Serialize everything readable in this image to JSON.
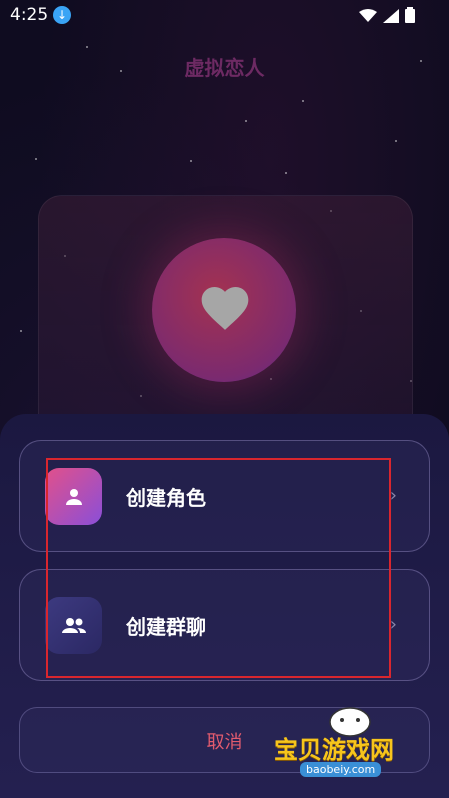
{
  "status_bar": {
    "time": "4:25"
  },
  "header": {
    "title": "虚拟恋人"
  },
  "card": {
    "icon": "heart-icon"
  },
  "options": [
    {
      "label": "创建角色",
      "icon": "person-icon"
    },
    {
      "label": "创建群聊",
      "icon": "group-icon"
    }
  ],
  "cancel": {
    "label": "取消"
  },
  "watermark": {
    "title": "宝贝游戏网",
    "url": "baobeiy.com"
  },
  "colors": {
    "background": "#0f0c20",
    "sheet": "#1b1840",
    "title": "#6d2a63",
    "cancel_text": "#e25b6e",
    "highlight_box": "#d9262e"
  }
}
